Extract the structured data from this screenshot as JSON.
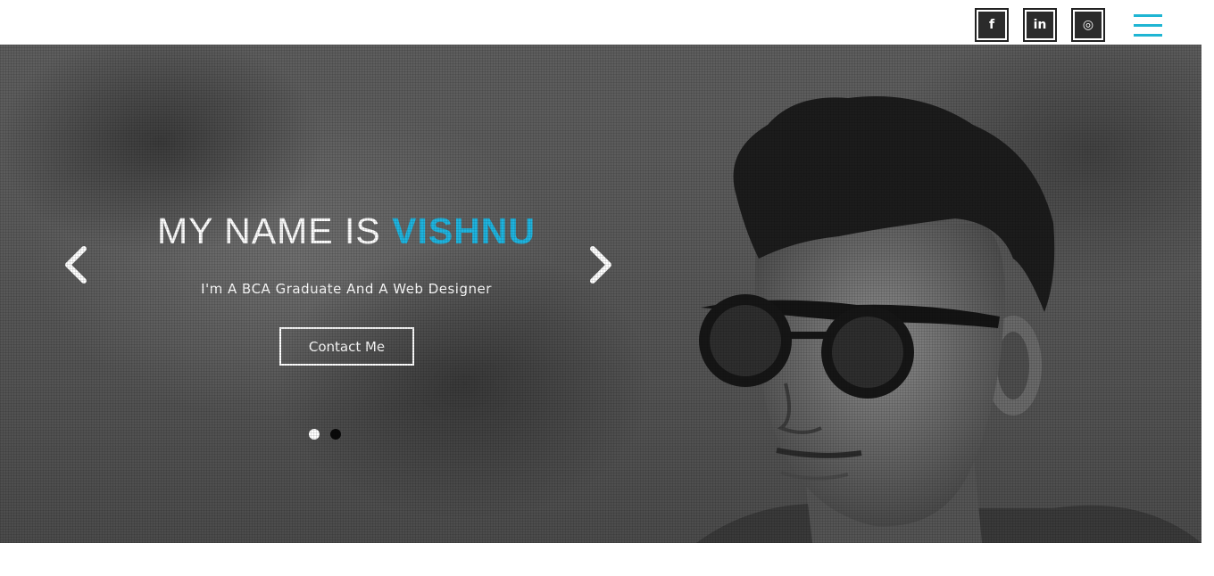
{
  "header": {
    "social": [
      {
        "name": "facebook-icon",
        "glyph": "f"
      },
      {
        "name": "linkedin-icon",
        "glyph": "in"
      },
      {
        "name": "instagram-icon",
        "glyph": "◎"
      }
    ],
    "menu_icon": "hamburger-menu-icon",
    "accent_color": "#1fb5d3"
  },
  "hero": {
    "title_prefix": "MY NAME IS ",
    "title_highlight": "VISHNU",
    "subtitle": "I'm A BCA Graduate And A Web Designer",
    "cta_label": "Contact Me",
    "highlight_color": "#1fb5e0",
    "prev_icon": "chevron-left-icon",
    "next_icon": "chevron-right-icon",
    "slides": {
      "count": 2,
      "active": 1
    }
  }
}
